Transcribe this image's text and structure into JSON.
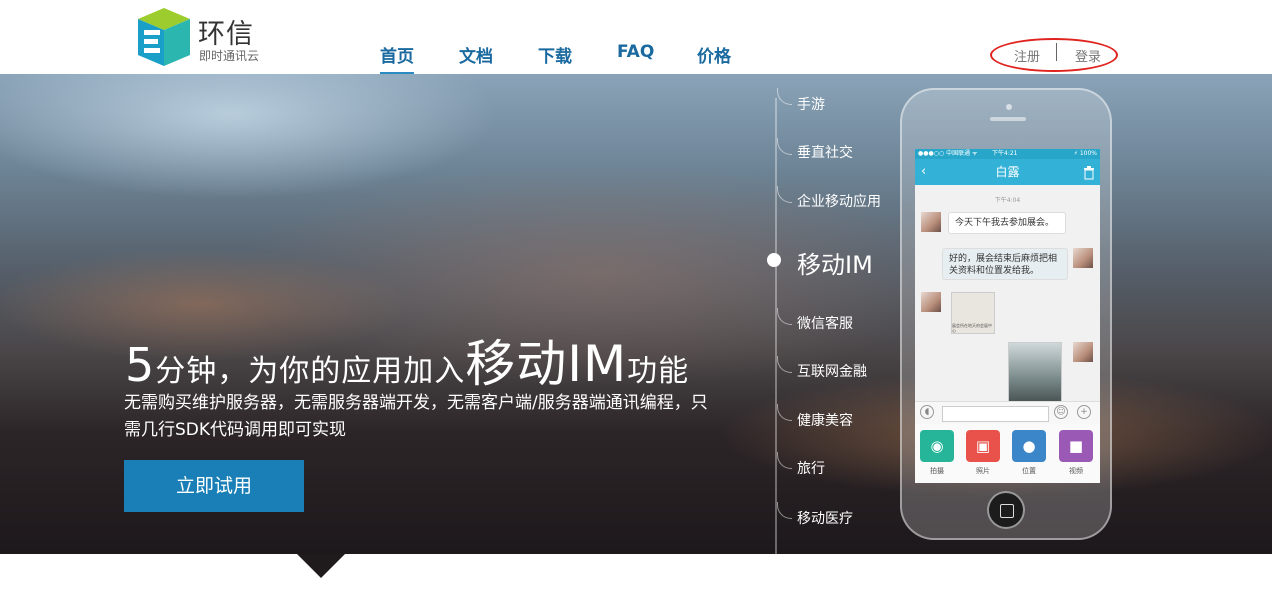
{
  "brand": {
    "title": "环信",
    "subtitle": "即时通讯云",
    "colors": {
      "accent": "#1a7fb6",
      "nav": "#1a6aa0",
      "highlight": "#e0231e"
    }
  },
  "nav": {
    "items": [
      {
        "label": "首页",
        "active": true
      },
      {
        "label": "文档"
      },
      {
        "label": "下载"
      },
      {
        "label": "FAQ"
      },
      {
        "label": "价格"
      }
    ]
  },
  "auth": {
    "register": "注册",
    "login": "登录"
  },
  "hero": {
    "title_lead": "5",
    "title_mid": "分钟，为你的应用加入",
    "title_big": "移动IM",
    "title_tail": "功能",
    "description": "无需购买维护服务器，无需服务器端开发，无需客户端/服务器端通讯编程，只需几行SDK代码调用即可实现",
    "cta": "立即试用"
  },
  "categories": [
    "手游",
    "垂直社交",
    "企业移动应用",
    "移动IM",
    "微信客服",
    "互联网金融",
    "健康美容",
    "旅行",
    "移动医疗"
  ],
  "phone": {
    "status": {
      "carrier": "●●●○○ 中国联通 ᯤ",
      "time": "下午4:21",
      "battery": "⚡ 100%"
    },
    "chat_title": "白露",
    "back_icon": "chevron-left-icon",
    "trash_icon": "trash-icon",
    "timestamp": "下午4:04",
    "messages": [
      {
        "side": "left",
        "text": "今天下午我去参加展会。"
      },
      {
        "side": "right",
        "text": "好的，展会结束后麻烦把相关资料和位置发给我。"
      }
    ],
    "map_caption": "展会所在地天府会展中心",
    "actions": [
      {
        "label": "拍摄",
        "icon": "camera-icon",
        "color": "#27b59a"
      },
      {
        "label": "照片",
        "icon": "photo-icon",
        "color": "#e8524a"
      },
      {
        "label": "位置",
        "icon": "location-pin-icon",
        "color": "#3a86c8"
      },
      {
        "label": "视频",
        "icon": "video-icon",
        "color": "#9b59b6"
      }
    ]
  }
}
